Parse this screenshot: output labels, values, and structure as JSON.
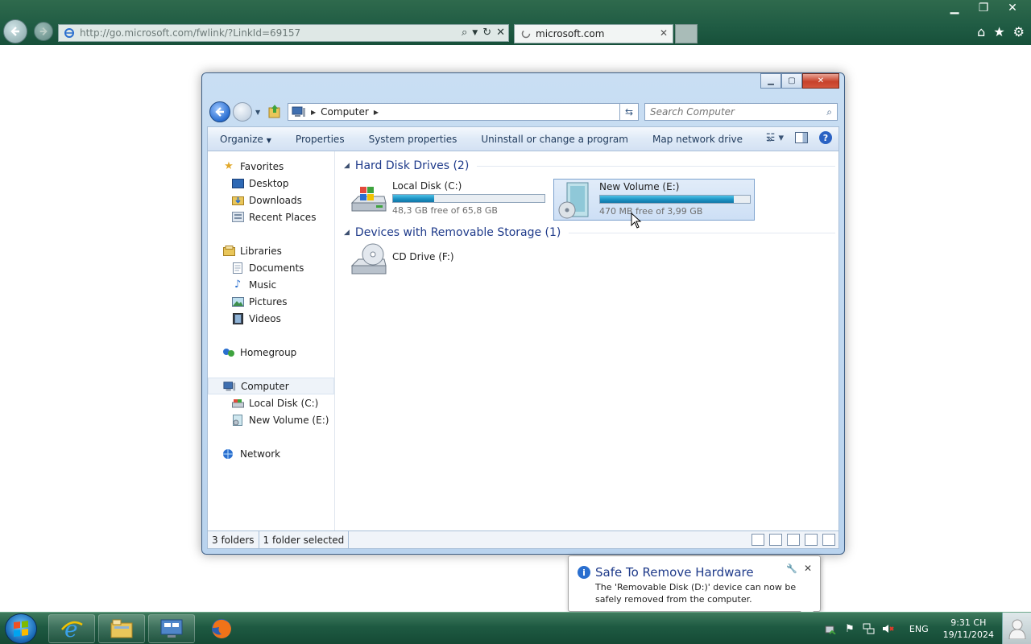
{
  "browser": {
    "address_url": "http://go.microsoft.com/fwlink/?LinkId=69157",
    "address_host": "microsoft.com",
    "tab_title": "microsoft.com"
  },
  "explorer": {
    "breadcrumb": "Computer",
    "search_placeholder": "Search Computer",
    "toolbar": {
      "organize": "Organize",
      "properties": "Properties",
      "system_properties": "System properties",
      "uninstall": "Uninstall or change a program",
      "map_drive": "Map network drive",
      "more": "»"
    },
    "nav": {
      "favorites": "Favorites",
      "desktop": "Desktop",
      "downloads": "Downloads",
      "recent_places": "Recent Places",
      "libraries": "Libraries",
      "documents": "Documents",
      "music": "Music",
      "pictures": "Pictures",
      "videos": "Videos",
      "homegroup": "Homegroup",
      "computer": "Computer",
      "local_disk": "Local Disk (C:)",
      "new_volume": "New Volume (E:)",
      "network": "Network"
    },
    "groups": {
      "hard_disks": "Hard Disk Drives (2)",
      "removable": "Devices with Removable Storage (1)"
    },
    "drives": [
      {
        "name": "Local Disk (C:)",
        "free": "48,3 GB free of 65,8 GB",
        "used_fraction": 0.27
      },
      {
        "name": "New Volume (E:)",
        "free": "470 MB free of 3,99 GB",
        "used_fraction": 0.89
      }
    ],
    "cd_drive": "CD Drive (F:)",
    "status": {
      "folders": "3 folders",
      "selected": "1 folder selected"
    }
  },
  "balloon": {
    "title": "Safe To Remove Hardware",
    "text": "The 'Removable Disk (D:)' device can now be safely removed from the computer."
  },
  "taskbar": {
    "lang": "ENG",
    "time": "9:31 CH",
    "date": "19/11/2024"
  },
  "colors": {
    "accent": "#1e3a8a",
    "taskbar": "#1e5a42",
    "drive_bar": "#1a8fc1"
  }
}
